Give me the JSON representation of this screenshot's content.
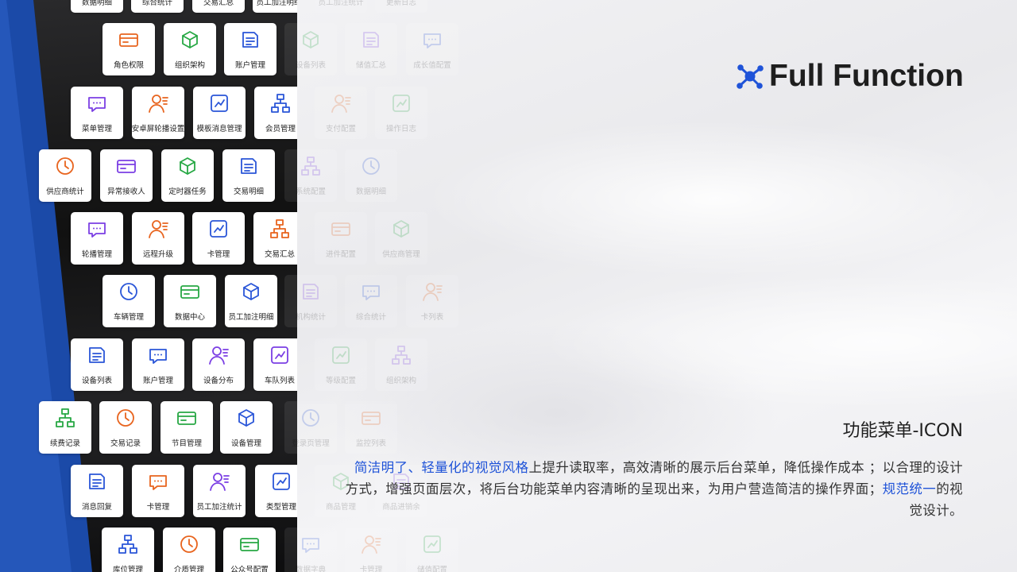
{
  "brand": {
    "title": "Full Function",
    "icon": "molecule-network-icon",
    "accent": "#1f53d8"
  },
  "section_title": "功能菜单-ICON",
  "description": {
    "highlight1": "简洁明了、轻量化的视觉风格",
    "text1": "上提升读取率，高效清晰的展示后台菜单，降低操作成本 ；以合理的设计方式，增强页面层次，将后台功能菜单内容清晰的呈现出来，为用户营造简洁的操作界面；",
    "highlight2": "规范统一",
    "text2": "的视觉设计。"
  },
  "tiles": [
    {
      "label": "数据明细",
      "icon": "data-detail-icon",
      "color": "#e8641e"
    },
    {
      "label": "综合统计",
      "icon": "overall-stats-icon",
      "color": "#2a56d8"
    },
    {
      "label": "交易汇总",
      "icon": "trade-summary-icon",
      "color": "#e8641e"
    },
    {
      "label": "员工加注明细",
      "icon": "staff-detail-icon",
      "color": "#2a56d8"
    },
    {
      "label": "角色权限",
      "icon": "role-permission-icon",
      "color": "#e8641e"
    },
    {
      "label": "组织架构",
      "icon": "org-chart-icon",
      "color": "#27a844"
    },
    {
      "label": "账户管理",
      "icon": "account-user-icon",
      "color": "#2a56d8"
    },
    {
      "label": "菜单管理",
      "icon": "menu-grid-icon",
      "color": "#7b3fe4"
    },
    {
      "label": "安卓屏轮播设置",
      "icon": "carousel-image-icon",
      "color": "#e8641e"
    },
    {
      "label": "模板消息管理",
      "icon": "template-copy-icon",
      "color": "#2a56d8"
    },
    {
      "label": "会员管理",
      "icon": "member-gear-icon",
      "color": "#2a56d8"
    },
    {
      "label": "供应商统计",
      "icon": "supplier-user-icon",
      "color": "#e8641e"
    },
    {
      "label": "异常接收人",
      "icon": "exception-user-icon",
      "color": "#7b3fe4"
    },
    {
      "label": "定时器任务",
      "icon": "alarm-clock-icon",
      "color": "#27a844"
    },
    {
      "label": "交易明细",
      "icon": "yen-book-icon",
      "color": "#2a56d8"
    },
    {
      "label": "轮播管理",
      "icon": "carousel-phone-icon",
      "color": "#7b3fe4"
    },
    {
      "label": "远程升级",
      "icon": "upgrade-arrow-icon",
      "color": "#e8641e"
    },
    {
      "label": "卡管理",
      "icon": "card-icon",
      "color": "#2a56d8"
    },
    {
      "label": "交易汇总",
      "icon": "receipt-icon",
      "color": "#e8641e"
    },
    {
      "label": "车辆管理",
      "icon": "vehicle-doc-icon",
      "color": "#2a56d8"
    },
    {
      "label": "数据中心",
      "icon": "data-box-icon",
      "color": "#27a844"
    },
    {
      "label": "员工加注明细",
      "icon": "staff-list-icon",
      "color": "#2a56d8"
    },
    {
      "label": "设备列表",
      "icon": "router-icon",
      "color": "#2a56d8"
    },
    {
      "label": "账户管理",
      "icon": "account-gear-icon",
      "color": "#2a56d8"
    },
    {
      "label": "设备分布",
      "icon": "map-pin-icon",
      "color": "#7b3fe4"
    },
    {
      "label": "车队列表",
      "icon": "car-wifi-icon",
      "color": "#7b3fe4"
    },
    {
      "label": "续费记录",
      "icon": "yen-plus-icon",
      "color": "#27a844"
    },
    {
      "label": "交易记录",
      "icon": "exchange-icon",
      "color": "#e8641e"
    },
    {
      "label": "节目管理",
      "icon": "play-board-icon",
      "color": "#27a844"
    },
    {
      "label": "设备管理",
      "icon": "device-frame-icon",
      "color": "#2a56d8"
    },
    {
      "label": "消息回复",
      "icon": "chat-bubble-icon",
      "color": "#2a56d8"
    },
    {
      "label": "卡管理",
      "icon": "card-tag-icon",
      "color": "#e8641e"
    },
    {
      "label": "员工加注统计",
      "icon": "staff-stats-icon",
      "color": "#7b3fe4"
    },
    {
      "label": "类型管理",
      "icon": "layers-icon",
      "color": "#2a56d8"
    },
    {
      "label": "库位管理",
      "icon": "storage-icon",
      "color": "#2a56d8"
    },
    {
      "label": "介质管理",
      "icon": "media-doc-icon",
      "color": "#e8641e"
    },
    {
      "label": "公众号配置",
      "icon": "badge-check-icon",
      "color": "#27a844"
    }
  ],
  "ghosts": [
    {
      "label": "员工加注统计",
      "icon": "faded-stats-icon"
    },
    {
      "label": "更新日志",
      "icon": "faded-log-icon"
    },
    {
      "label": "设备列表",
      "icon": "faded-router-icon"
    },
    {
      "label": "储值汇总",
      "icon": "faded-inbox-icon"
    },
    {
      "label": "成长值配置",
      "icon": "faded-db-icon"
    },
    {
      "label": "支付配置",
      "icon": "faded-pay-icon"
    },
    {
      "label": "操作日志",
      "icon": "faded-edit-icon"
    },
    {
      "label": "系统配置",
      "icon": "faded-org-icon"
    },
    {
      "label": "数据明细",
      "icon": "faded-chart-icon"
    },
    {
      "label": "进件配置",
      "icon": "faded-doc-icon"
    },
    {
      "label": "供应商管理",
      "icon": "faded-user-icon"
    },
    {
      "label": "机构统计",
      "icon": "faded-bar-icon"
    },
    {
      "label": "综合统计",
      "icon": "faded-pie-icon"
    },
    {
      "label": "卡列表",
      "icon": "faded-card-icon"
    },
    {
      "label": "等级配置",
      "icon": "faded-pyramid-icon"
    },
    {
      "label": "组织架构",
      "icon": "faded-org2-icon"
    },
    {
      "label": "登录页管理",
      "icon": "faded-login-icon"
    },
    {
      "label": "监控列表",
      "icon": "faded-monitor-icon"
    },
    {
      "label": "商品管理",
      "icon": "faded-box-icon"
    },
    {
      "label": "商品进销余",
      "icon": "faded-goods-icon"
    },
    {
      "label": "数据字典",
      "icon": "faded-book-icon"
    },
    {
      "label": "卡管理",
      "icon": "faded-card2-icon"
    },
    {
      "label": "储值配置",
      "icon": "faded-bag-icon"
    }
  ]
}
